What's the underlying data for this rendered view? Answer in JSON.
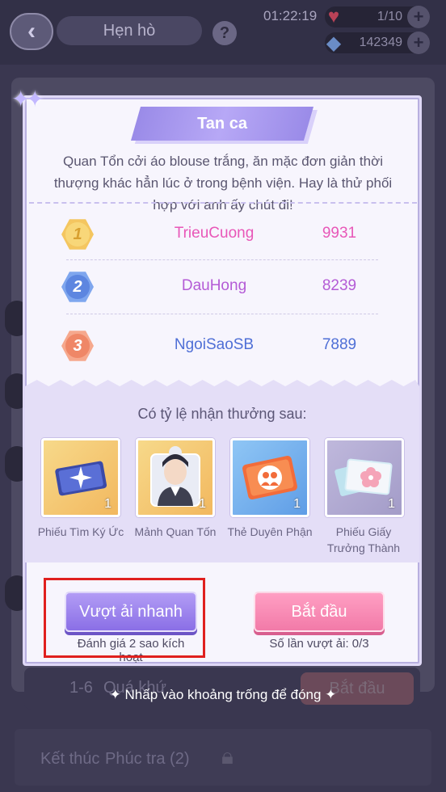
{
  "header": {
    "title": "Hẹn hò",
    "time": "01:22:19",
    "hearts": "1/10",
    "diamonds": "142349"
  },
  "background": {
    "stage_level": "1-6",
    "stage_name": "Quá khứ",
    "stage_button": "Bắt đầu",
    "bottom_left": "Kết thúc",
    "bottom_right": "Phúc tra (2)"
  },
  "modal": {
    "title": "Tan ca",
    "description": "Quan Tổn cởi áo blouse trắng, ăn mặc đơn giản thời thượng khác hẳn lúc ở trong bệnh viện. Hay là thử phối hợp với anh ấy chút đi!",
    "leaderboard": [
      {
        "rank": "1",
        "name": "TrieuCuong",
        "score": "9931",
        "name_color": "#e857b8",
        "score_color": "#e857b8"
      },
      {
        "rank": "2",
        "name": "DauHong",
        "score": "8239",
        "name_color": "#b45bd6",
        "score_color": "#b45bd6"
      },
      {
        "rank": "3",
        "name": "NgoiSaoSB",
        "score": "7889",
        "name_color": "#4f6fd6",
        "score_color": "#4f6fd6"
      }
    ],
    "reward_title": "Có tỷ lệ nhận thưởng sau:",
    "rewards": [
      {
        "label": "Phiếu Tìm Ký Ức",
        "qty": "1",
        "icon": "ticket-star-icon"
      },
      {
        "label": "Mảnh Quan Tốn",
        "qty": "1",
        "icon": "puzzle-portrait-icon"
      },
      {
        "label": "Thẻ Duyên Phận",
        "qty": "1",
        "icon": "couple-card-icon"
      },
      {
        "label": "Phiếu Giấy Trưởng Thành",
        "qty": "1",
        "icon": "flower-coupon-icon"
      }
    ],
    "fast_button": "Vượt ải nhanh",
    "fast_note": "Đánh giá 2 sao kích hoạt",
    "start_button": "Bắt đầu",
    "attempts_note": "Số lần vượt ải: 0/3"
  },
  "close_hint": "✦ Nhấp vào khoảng trống để đóng ✦"
}
